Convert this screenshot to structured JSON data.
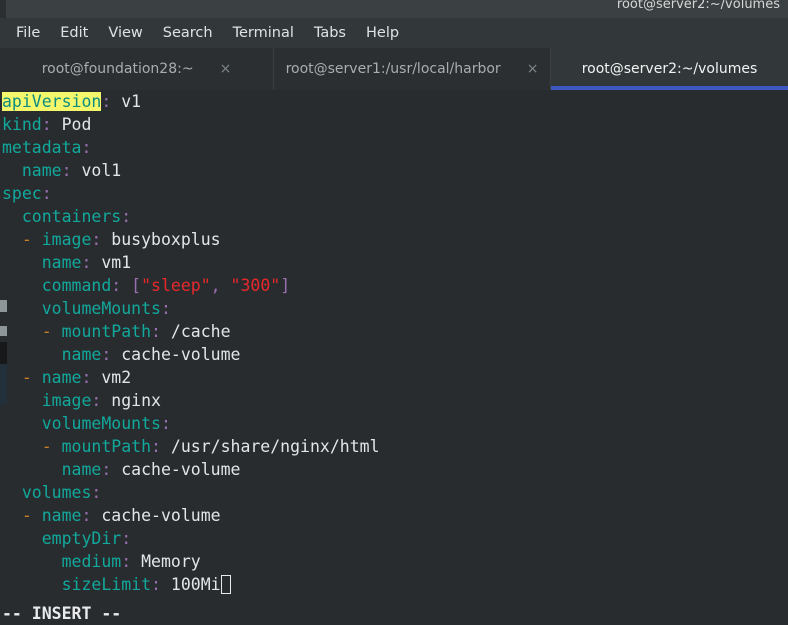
{
  "window": {
    "title": "root@server2:~/volumes"
  },
  "menubar": {
    "items": [
      {
        "label": "File"
      },
      {
        "label": "Edit"
      },
      {
        "label": "View"
      },
      {
        "label": "Search"
      },
      {
        "label": "Terminal"
      },
      {
        "label": "Tabs"
      },
      {
        "label": "Help"
      }
    ]
  },
  "tabs": {
    "close_glyph": "×",
    "items": [
      {
        "label": "root@foundation28:~",
        "active": false
      },
      {
        "label": "root@server1:/usr/local/harbor",
        "active": false
      },
      {
        "label": "root@server2:~/volumes",
        "active": true
      }
    ],
    "active_underline_color": "#3f57c0"
  },
  "terminal": {
    "editor_mode": "-- INSERT --",
    "cursor": {
      "shape": "hollow-block",
      "after_text": "100Mi"
    },
    "colors": {
      "background": "#282c2f",
      "key": "#12a89c",
      "punctuation": "#9a6fb0",
      "value": "#e3e6e7",
      "string": "#e8282b",
      "dash": "#c87f24",
      "highlight_bg": "#f4f76b",
      "highlight_fg": "#0e8d7f"
    },
    "lines": [
      {
        "indent": "",
        "key": "apiVersion",
        "colon": ":",
        "value": " v1",
        "highlight": true
      },
      {
        "indent": "",
        "key": "kind",
        "colon": ":",
        "value": " Pod"
      },
      {
        "indent": "",
        "key": "metadata",
        "colon": ":",
        "value": ""
      },
      {
        "indent": "  ",
        "key": "name",
        "colon": ":",
        "value": " vol1"
      },
      {
        "indent": "",
        "key": "spec",
        "colon": ":",
        "value": ""
      },
      {
        "indent": "  ",
        "key": "containers",
        "colon": ":",
        "value": ""
      },
      {
        "indent": "  ",
        "dash": "- ",
        "key": "image",
        "colon": ":",
        "value": " busyboxplus"
      },
      {
        "indent": "    ",
        "key": "name",
        "colon": ":",
        "value": " vm1"
      },
      {
        "indent": "    ",
        "key": "command",
        "colon": ":",
        "value": "",
        "array": [
          "\"sleep\"",
          "\"300\""
        ]
      },
      {
        "indent": "    ",
        "key": "volumeMounts",
        "colon": ":",
        "value": ""
      },
      {
        "indent": "    ",
        "dash": "- ",
        "key": "mountPath",
        "colon": ":",
        "value": " /cache"
      },
      {
        "indent": "      ",
        "key": "name",
        "colon": ":",
        "value": " cache-volume"
      },
      {
        "indent": "  ",
        "dash": "- ",
        "key": "name",
        "colon": ":",
        "value": " vm2"
      },
      {
        "indent": "    ",
        "key": "image",
        "colon": ":",
        "value": " nginx"
      },
      {
        "indent": "    ",
        "key": "volumeMounts",
        "colon": ":",
        "value": ""
      },
      {
        "indent": "    ",
        "dash": "- ",
        "key": "mountPath",
        "colon": ":",
        "value": " /usr/share/nginx/html"
      },
      {
        "indent": "      ",
        "key": "name",
        "colon": ":",
        "value": " cache-volume"
      },
      {
        "indent": "  ",
        "key": "volumes",
        "colon": ":",
        "value": ""
      },
      {
        "indent": "  ",
        "dash": "- ",
        "key": "name",
        "colon": ":",
        "value": " cache-volume"
      },
      {
        "indent": "    ",
        "key": "emptyDir",
        "colon": ":",
        "value": ""
      },
      {
        "indent": "      ",
        "key": "medium",
        "colon": ":",
        "value": " Memory"
      },
      {
        "indent": "      ",
        "key": "sizeLimit",
        "colon": ":",
        "value": " 100Mi",
        "cursor": true
      }
    ]
  }
}
